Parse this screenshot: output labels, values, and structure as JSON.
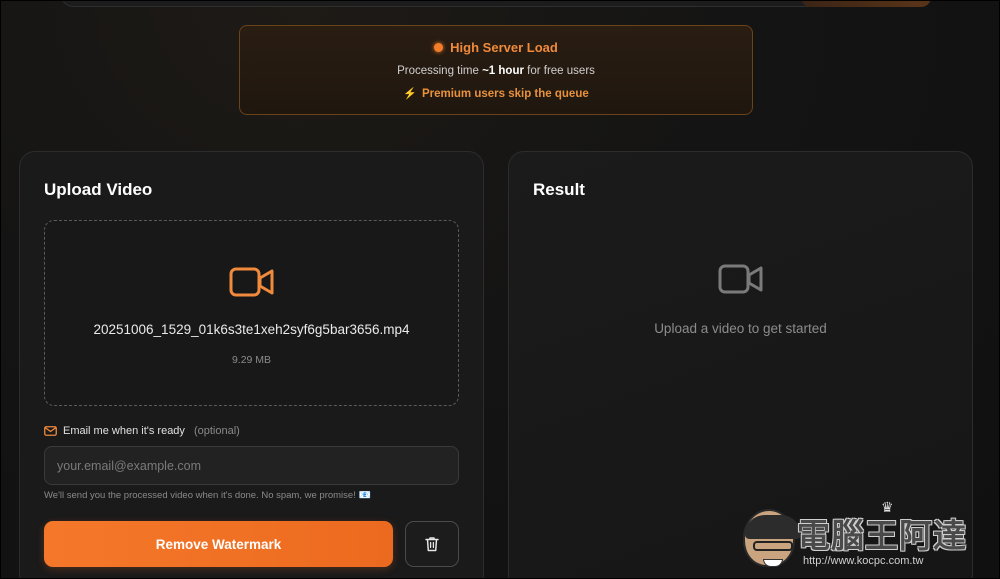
{
  "banner": {
    "title": "High Server Load",
    "processing_prefix": "Processing time ",
    "processing_time": "~1 hour",
    "processing_suffix": " for free users",
    "premium_text": "Premium users skip the queue",
    "icon": "bolt-icon",
    "status_color": "#f47d2a"
  },
  "upload": {
    "title": "Upload Video",
    "file_name": "20251006_1529_01k6s3te1xeh2syf6g5bar3656.mp4",
    "file_size": "9.29 MB",
    "icon": "video-icon",
    "email_label": "Email me when it's ready",
    "email_optional": "(optional)",
    "email_placeholder": "your.email@example.com",
    "email_note": "We'll send you the processed video when it's done. No spam, we promise!",
    "primary_button": "Remove Watermark",
    "delete_icon": "trash-icon",
    "accent_color": "#f5782a"
  },
  "result": {
    "title": "Result",
    "placeholder": "Upload a video to get started",
    "icon": "video-icon"
  },
  "watermark": {
    "title": "電腦王阿達",
    "url": "http://www.kocpc.com.tw"
  }
}
